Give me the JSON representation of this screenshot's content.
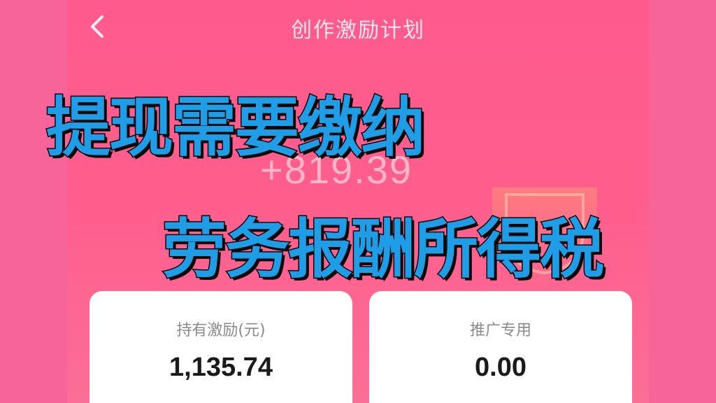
{
  "nav": {
    "title": "创作激励计划"
  },
  "summary": {
    "partial_label": "",
    "amount": "+819.39"
  },
  "overlay": {
    "line1": "提现需要缴纳",
    "line2": "劳务报酬所得税"
  },
  "cards": [
    {
      "label": "持有激励(元)",
      "value": "1,135.74"
    },
    {
      "label": "推广专用",
      "value": "0.00"
    }
  ],
  "colors": {
    "background": "#ff5f8d",
    "overlay_text": "#1f9de6",
    "overlay_stroke": "#0a0a0a"
  },
  "icons": {
    "back": "chevron-left-icon"
  }
}
